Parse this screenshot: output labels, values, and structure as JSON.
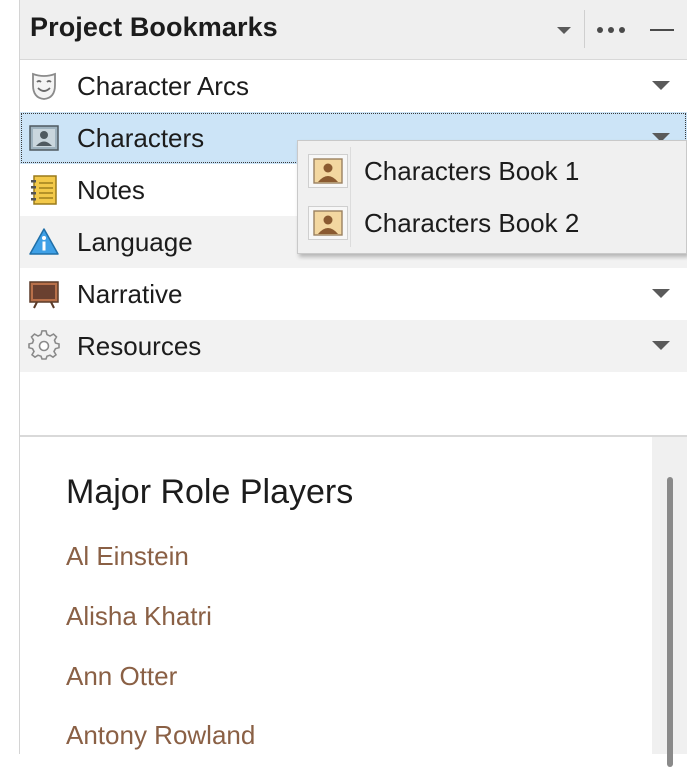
{
  "panel": {
    "title": "Project Bookmarks",
    "header_icons": [
      "chevron-down-icon",
      "more-horizontal-icon",
      "minimize-icon"
    ]
  },
  "bookmarks": [
    {
      "label": "Character Arcs",
      "icon": "theater-mask-icon",
      "has_menu": true,
      "selected": false
    },
    {
      "label": "Characters",
      "icon": "portrait-icon",
      "has_menu": true,
      "selected": true
    },
    {
      "label": "Notes",
      "icon": "notebook-icon",
      "has_menu": false,
      "selected": false
    },
    {
      "label": "Language",
      "icon": "info-triangle-icon",
      "has_menu": false,
      "selected": false
    },
    {
      "label": "Narrative",
      "icon": "presentation-board-icon",
      "has_menu": true,
      "selected": false
    },
    {
      "label": "Resources",
      "icon": "gear-icon",
      "has_menu": true,
      "selected": false
    }
  ],
  "popup_menu": {
    "items": [
      {
        "label": "Characters Book 1",
        "icon": "character-card-icon"
      },
      {
        "label": "Characters Book 2",
        "icon": "character-card-icon"
      }
    ]
  },
  "document": {
    "title": "Major Role Players",
    "people": [
      "Al Einstein",
      "Alisha Khatri",
      "Ann Otter",
      "Antony Rowland"
    ]
  },
  "colors": {
    "selection": "#cce4f7",
    "header_bg": "#efefef",
    "link_brown": "#8a6045",
    "alt_row": "#f2f2f2"
  }
}
